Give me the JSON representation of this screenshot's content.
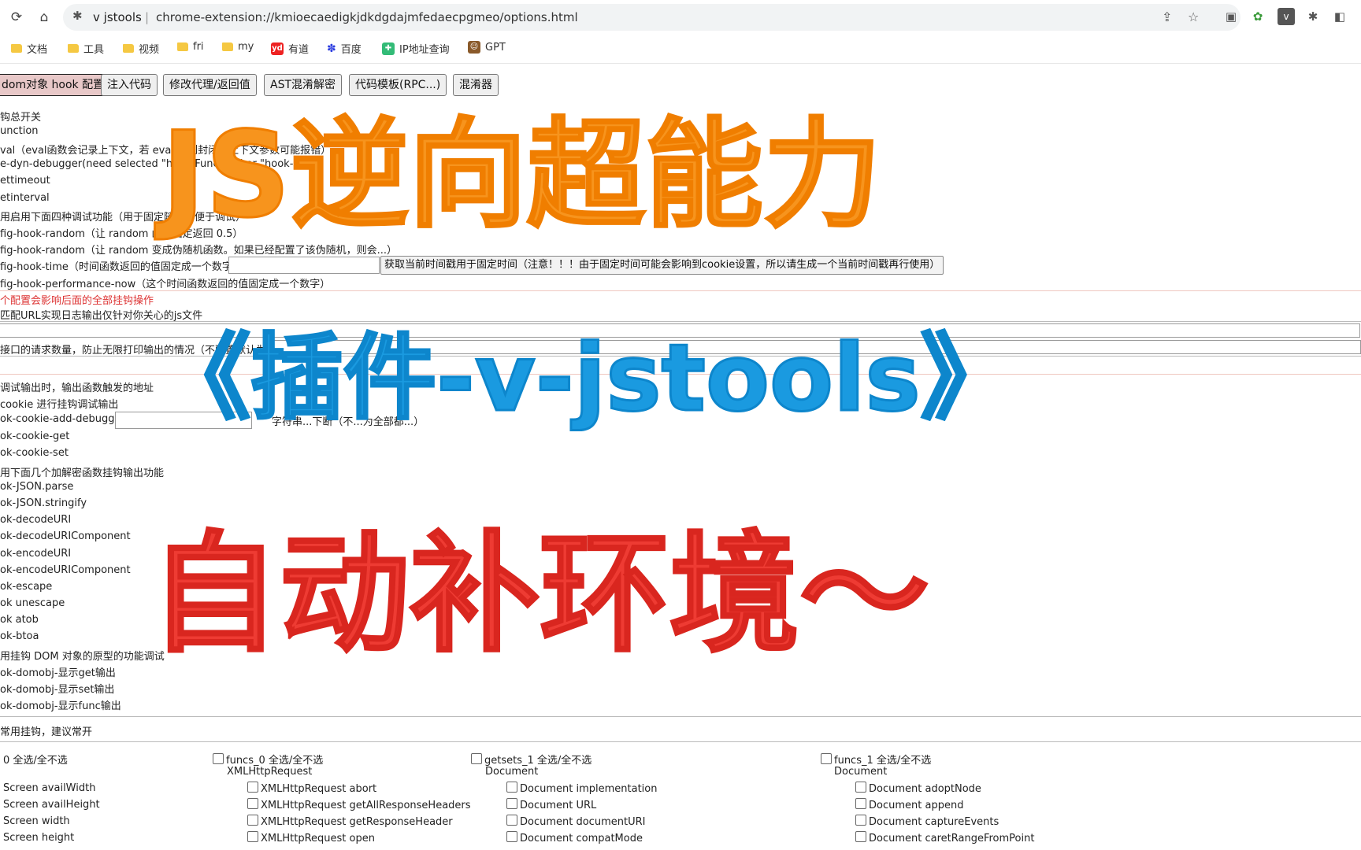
{
  "browser": {
    "tab_title": "v jstools",
    "url": "chrome-extension://kmioecaedigkjdkdgdajmfedaecpgmeo/options.html",
    "bookmarks": [
      "文档",
      "工具",
      "视频",
      "fri",
      "my",
      "有道",
      "百度",
      "IP地址查询",
      "GPT"
    ]
  },
  "tabs": [
    "dom对象 hook 配置",
    "注入代码",
    "修改代理/返回值",
    "AST混淆解密",
    "代码模板(RPC...)",
    "混淆器"
  ],
  "config_lines": [
    "钩总开关",
    "unction",
    "val（eval函数会记录上下文，若 eval 用到封闭的上下文参数可能报错）",
    "e-dyn-debugger(need selected \"hook-Function\" or \"hook-eval\")",
    "ettimeout",
    "etinterval",
    "用启用下面四种调试功能（用于固定随机，便于调试）",
    "fig-hook-random（让 random 函数固定返回 0.5）",
    "fig-hook-random（让 random 变成伪随机函数。如果已经配置了该伪随机，则会...）",
    "fig-hook-time（时间函数返回的值固定成一个数字）",
    "fig-hook-performance-now（这个时间函数返回的值固定成一个数字）"
  ],
  "time_button": "获取当前时间戳用于固定时间（注意！！！由于固定时间可能会影响到cookie设置，所以请生成一个当前时间戳再行使用）",
  "warning": "个配置会影响后面的全部挂钩操作",
  "url_filter_label": "匹配URL实现日志输出仅针对你关心的js文件",
  "request_limit_label": "接口的请求数量，防止无限打印输出的情况（不配置默认为30）",
  "debug_lines": [
    "调试输出时，输出函数触发的地址",
    "cookie 进行挂钩调试输出",
    "ok-cookie-add-debugger",
    "字符串...下断（不...为全部都...）",
    "ok-cookie-get",
    "ok-cookie-set",
    "用下面几个加解密函数挂钩输出功能",
    "ok-JSON.parse",
    "ok-JSON.stringify",
    "ok-decodeURI",
    "ok-decodeURIComponent",
    "ok-encodeURI",
    "ok-encodeURIComponent",
    "ok-escape",
    "ok unescape",
    "ok atob",
    "ok-btoa",
    "用挂钩 DOM 对象的原型的功能调试",
    "ok-domobj-显示get输出",
    "ok-domobj-显示set输出",
    "ok-domobj-显示func输出"
  ],
  "common_hooks_label": "常用挂钩，建议常开",
  "columns": [
    {
      "header": "0 全选/全不选",
      "group": "",
      "items": [
        "Screen availWidth",
        "Screen availHeight",
        "Screen width",
        "Screen height"
      ]
    },
    {
      "header": "funcs_0 全选/全不选",
      "group": "XMLHttpRequest",
      "items": [
        "XMLHttpRequest abort",
        "XMLHttpRequest getAllResponseHeaders",
        "XMLHttpRequest getResponseHeader",
        "XMLHttpRequest open"
      ]
    },
    {
      "header": "getsets_1 全选/全不选",
      "group": "Document",
      "items": [
        "Document implementation",
        "Document URL",
        "Document documentURI",
        "Document compatMode"
      ]
    },
    {
      "header": "funcs_1 全选/全不选",
      "group": "Document",
      "items": [
        "Document adoptNode",
        "Document append",
        "Document captureEvents",
        "Document caretRangeFromPoint"
      ]
    }
  ],
  "overlay": {
    "line1": "JS逆向超能力",
    "line2": "《插件-v-jstools》",
    "line3": "自动补环境～"
  },
  "colors": {
    "orange": "#f7941d",
    "blue": "#1a9ae0",
    "red": "#ee3b33"
  }
}
